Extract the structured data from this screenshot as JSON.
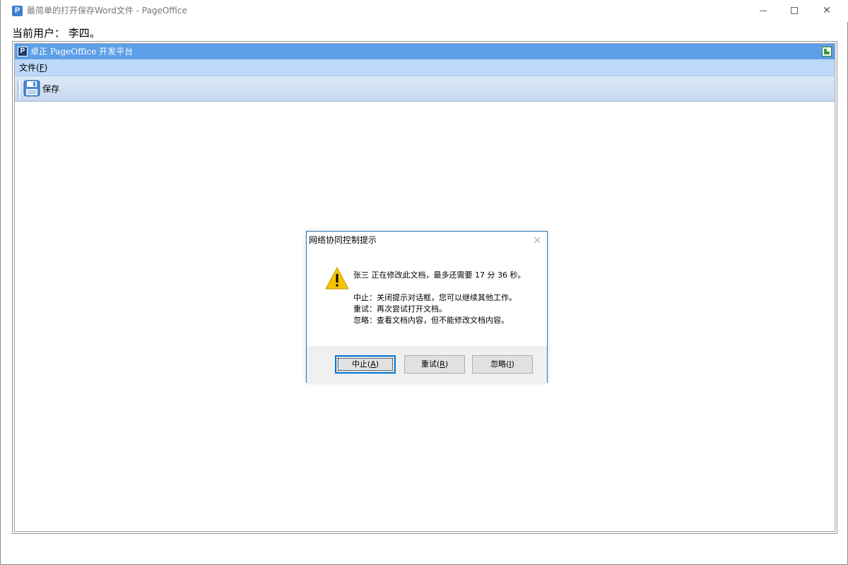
{
  "window": {
    "title": "最简单的打开保存Word文件 - PageOffice",
    "icon_letter": "P",
    "minimize_icon": "minimize-icon",
    "maximize_icon": "maximize-icon",
    "close_glyph": "✕"
  },
  "page": {
    "current_user": "当前用户： 李四。"
  },
  "pageoffice": {
    "title": "卓正 PageOffice 开发平台",
    "logo_letter": "P",
    "menu": {
      "file_label": "文件(",
      "file_key": "F",
      "file_end": ")"
    },
    "toolbar": {
      "save_label": "保存"
    }
  },
  "dialog": {
    "title": "网络协同控制提示",
    "close_glyph": "✕",
    "message": "张三 正在修改此文档，最多还需要 17 分 36 秒。",
    "lines": [
      "中止：关闭提示对话框，您可以继续其他工作。",
      "重试：再次尝试打开文档。",
      "忽略：查看文档内容，但不能修改文档内容。"
    ],
    "buttons": {
      "abort": {
        "label": "中止(",
        "key": "A",
        "end": ")"
      },
      "retry": {
        "label": "重试(",
        "key": "R",
        "end": ")"
      },
      "ignore": {
        "label": "忽略(",
        "key": "I",
        "end": ")"
      }
    }
  },
  "colors": {
    "po_titlebar": "#5c9ee8",
    "po_menubar": "#bcd9f7",
    "dialog_border": "#2b79b7",
    "focus_button": "#0078d7",
    "warning": "#f5c400"
  }
}
